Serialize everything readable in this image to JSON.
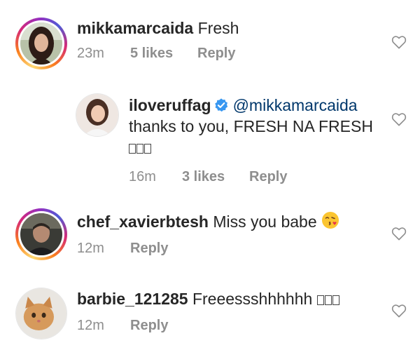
{
  "comments": [
    {
      "username": "mikkamarcaida",
      "text": "Fresh",
      "time": "23m",
      "likes": "5 likes",
      "reply": "Reply",
      "avatar_story_ring": true
    },
    {
      "username": "iloveruffag",
      "verified": true,
      "mention": "@mikkamarcaida",
      "text_line1": "thanks to you, FRESH NA FRESH",
      "time": "16m",
      "likes": "3 likes",
      "reply": "Reply",
      "avatar_story_ring": false
    },
    {
      "username": "chef_xavierbtesh",
      "text": "Miss you babe",
      "emoji": "face-blowing-kiss",
      "time": "12m",
      "reply": "Reply",
      "avatar_story_ring": true
    },
    {
      "username": "barbie_121285",
      "text": "Freeessshhhhhh",
      "time": "12m",
      "reply": "Reply",
      "avatar_story_ring": false
    }
  ],
  "icons": {
    "like": "heart-outline-icon",
    "verified": "verified-badge-icon"
  },
  "colors": {
    "text": "#262626",
    "meta": "#8e8e8e",
    "mention": "#00376b",
    "verified": "#3897f0"
  }
}
